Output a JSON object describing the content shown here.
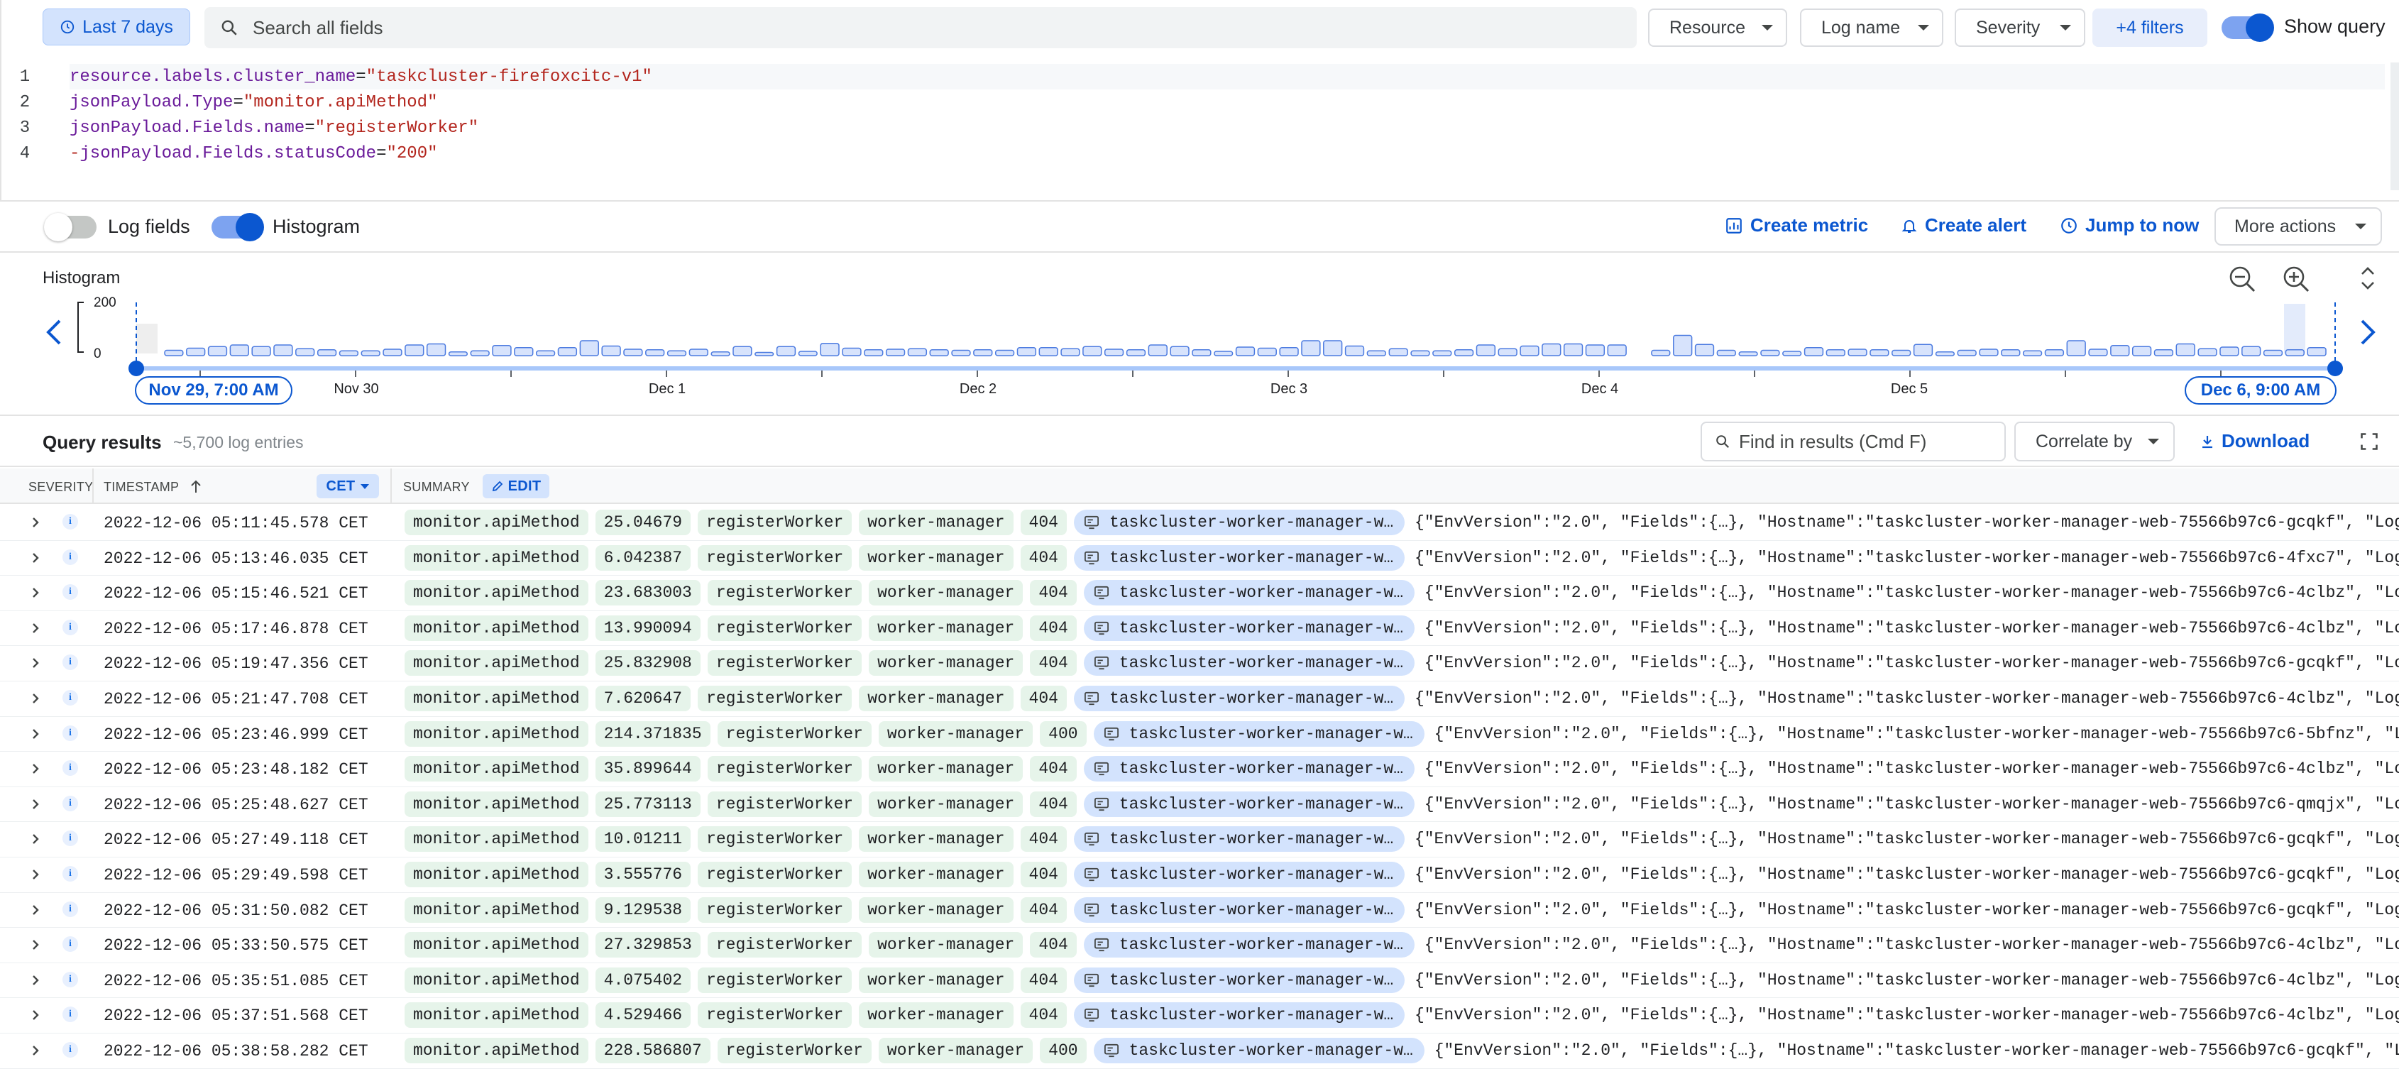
{
  "topbar": {
    "time_range": "Last 7 days",
    "search_placeholder": "Search all fields",
    "resource_label": "Resource",
    "log_name_label": "Log name",
    "severity_label": "Severity",
    "more_filters": "+4 filters",
    "show_query_label": "Show query",
    "show_query_on": true
  },
  "query": {
    "lines": [
      {
        "num": "1",
        "key": "resource.labels.cluster_name",
        "op": "=",
        "value": "\"taskcluster-firefoxcitc-v1\"",
        "negate": ""
      },
      {
        "num": "2",
        "key": "jsonPayload.Type",
        "op": "=",
        "value": "\"monitor.apiMethod\"",
        "negate": ""
      },
      {
        "num": "3",
        "key": "jsonPayload.Fields.name",
        "op": "=",
        "value": "\"registerWorker\"",
        "negate": ""
      },
      {
        "num": "4",
        "key": "jsonPayload.Fields.statusCode",
        "op": "=",
        "value": "\"200\"",
        "negate": "-"
      }
    ]
  },
  "options": {
    "log_fields_label": "Log fields",
    "log_fields_on": false,
    "histogram_label": "Histogram",
    "histogram_on": true,
    "create_metric": "Create metric",
    "create_alert": "Create alert",
    "jump_to_now": "Jump to now",
    "more_actions": "More actions"
  },
  "histogram": {
    "title": "Histogram",
    "y_ticks": [
      "200",
      "0"
    ],
    "x_labels": [
      "Nov 30",
      "Dec 1",
      "Dec 2",
      "Dec 3",
      "Dec 4",
      "Dec 5"
    ],
    "range_start": "Nov 29, 7:00 AM",
    "range_end": "Dec 6, 9:00 AM",
    "ymax": 200,
    "values": [
      20,
      28,
      34,
      40,
      34,
      40,
      26,
      22,
      18,
      18,
      24,
      40,
      44,
      14,
      18,
      38,
      30,
      18,
      30,
      56,
      36,
      24,
      22,
      18,
      24,
      14,
      34,
      12,
      34,
      16,
      46,
      28,
      22,
      24,
      26,
      22,
      20,
      22,
      20,
      30,
      30,
      26,
      34,
      24,
      22,
      40,
      34,
      22,
      16,
      32,
      28,
      30,
      56,
      56,
      36,
      18,
      26,
      18,
      18,
      22,
      40,
      26,
      36,
      44,
      44,
      40,
      40,
      0,
      20,
      76,
      42,
      20,
      14,
      20,
      16,
      30,
      22,
      24,
      22,
      20,
      42,
      14,
      20,
      24,
      22,
      18,
      22,
      56,
      24,
      38,
      34,
      22,
      44,
      26,
      32,
      34,
      20,
      22,
      30
    ]
  },
  "results": {
    "title": "Query results",
    "count": "~5,700 log entries",
    "find_placeholder": "Find in results (Cmd F)",
    "correlate_label": "Correlate by",
    "download_label": "Download",
    "col_severity": "SEVERITY",
    "col_timestamp": "TIMESTAMP",
    "timezone": "CET",
    "col_summary": "SUMMARY",
    "edit_label": "EDIT",
    "rows": [
      {
        "ts": "2022-12-06 05:11:45.578 CET",
        "type": "monitor.apiMethod",
        "dur": "25.04679",
        "name": "registerWorker",
        "svc": "worker-manager",
        "code": "404",
        "host": "taskcluster-worker-manager-web…",
        "json": "{\"EnvVersion\":\"2.0\", \"Fields\":{…}, \"Hostname\":\"taskcluster-worker-manager-web-75566b97c6-gcqkf\", \"Logg…"
      },
      {
        "ts": "2022-12-06 05:13:46.035 CET",
        "type": "monitor.apiMethod",
        "dur": "6.042387",
        "name": "registerWorker",
        "svc": "worker-manager",
        "code": "404",
        "host": "taskcluster-worker-manager-web…",
        "json": "{\"EnvVersion\":\"2.0\", \"Fields\":{…}, \"Hostname\":\"taskcluster-worker-manager-web-75566b97c6-4fxc7\", \"Logg…"
      },
      {
        "ts": "2022-12-06 05:15:46.521 CET",
        "type": "monitor.apiMethod",
        "dur": "23.683003",
        "name": "registerWorker",
        "svc": "worker-manager",
        "code": "404",
        "host": "taskcluster-worker-manager-web…",
        "json": "{\"EnvVersion\":\"2.0\", \"Fields\":{…}, \"Hostname\":\"taskcluster-worker-manager-web-75566b97c6-4clbz\", \"Log…"
      },
      {
        "ts": "2022-12-06 05:17:46.878 CET",
        "type": "monitor.apiMethod",
        "dur": "13.990094",
        "name": "registerWorker",
        "svc": "worker-manager",
        "code": "404",
        "host": "taskcluster-worker-manager-web…",
        "json": "{\"EnvVersion\":\"2.0\", \"Fields\":{…}, \"Hostname\":\"taskcluster-worker-manager-web-75566b97c6-4clbz\", \"Log…"
      },
      {
        "ts": "2022-12-06 05:19:47.356 CET",
        "type": "monitor.apiMethod",
        "dur": "25.832908",
        "name": "registerWorker",
        "svc": "worker-manager",
        "code": "404",
        "host": "taskcluster-worker-manager-web…",
        "json": "{\"EnvVersion\":\"2.0\", \"Fields\":{…}, \"Hostname\":\"taskcluster-worker-manager-web-75566b97c6-gcqkf\", \"Log…"
      },
      {
        "ts": "2022-12-06 05:21:47.708 CET",
        "type": "monitor.apiMethod",
        "dur": "7.620647",
        "name": "registerWorker",
        "svc": "worker-manager",
        "code": "404",
        "host": "taskcluster-worker-manager-web…",
        "json": "{\"EnvVersion\":\"2.0\", \"Fields\":{…}, \"Hostname\":\"taskcluster-worker-manager-web-75566b97c6-4clbz\", \"Logg…"
      },
      {
        "ts": "2022-12-06 05:23:46.999 CET",
        "type": "monitor.apiMethod",
        "dur": "214.371835",
        "name": "registerWorker",
        "svc": "worker-manager",
        "code": "400",
        "host": "taskcluster-worker-manager-web…",
        "json": "{\"EnvVersion\":\"2.0\", \"Fields\":{…}, \"Hostname\":\"taskcluster-worker-manager-web-75566b97c6-5bfnz\", \"Lo…"
      },
      {
        "ts": "2022-12-06 05:23:48.182 CET",
        "type": "monitor.apiMethod",
        "dur": "35.899644",
        "name": "registerWorker",
        "svc": "worker-manager",
        "code": "404",
        "host": "taskcluster-worker-manager-web…",
        "json": "{\"EnvVersion\":\"2.0\", \"Fields\":{…}, \"Hostname\":\"taskcluster-worker-manager-web-75566b97c6-4clbz\", \"Log…"
      },
      {
        "ts": "2022-12-06 05:25:48.627 CET",
        "type": "monitor.apiMethod",
        "dur": "25.773113",
        "name": "registerWorker",
        "svc": "worker-manager",
        "code": "404",
        "host": "taskcluster-worker-manager-web…",
        "json": "{\"EnvVersion\":\"2.0\", \"Fields\":{…}, \"Hostname\":\"taskcluster-worker-manager-web-75566b97c6-qmqjx\", \"Log…"
      },
      {
        "ts": "2022-12-06 05:27:49.118 CET",
        "type": "monitor.apiMethod",
        "dur": "10.01211",
        "name": "registerWorker",
        "svc": "worker-manager",
        "code": "404",
        "host": "taskcluster-worker-manager-web…",
        "json": "{\"EnvVersion\":\"2.0\", \"Fields\":{…}, \"Hostname\":\"taskcluster-worker-manager-web-75566b97c6-gcqkf\", \"Logg…"
      },
      {
        "ts": "2022-12-06 05:29:49.598 CET",
        "type": "monitor.apiMethod",
        "dur": "3.555776",
        "name": "registerWorker",
        "svc": "worker-manager",
        "code": "404",
        "host": "taskcluster-worker-manager-web…",
        "json": "{\"EnvVersion\":\"2.0\", \"Fields\":{…}, \"Hostname\":\"taskcluster-worker-manager-web-75566b97c6-gcqkf\", \"Logg…"
      },
      {
        "ts": "2022-12-06 05:31:50.082 CET",
        "type": "monitor.apiMethod",
        "dur": "9.129538",
        "name": "registerWorker",
        "svc": "worker-manager",
        "code": "404",
        "host": "taskcluster-worker-manager-web…",
        "json": "{\"EnvVersion\":\"2.0\", \"Fields\":{…}, \"Hostname\":\"taskcluster-worker-manager-web-75566b97c6-gcqkf\", \"Logg…"
      },
      {
        "ts": "2022-12-06 05:33:50.575 CET",
        "type": "monitor.apiMethod",
        "dur": "27.329853",
        "name": "registerWorker",
        "svc": "worker-manager",
        "code": "404",
        "host": "taskcluster-worker-manager-web…",
        "json": "{\"EnvVersion\":\"2.0\", \"Fields\":{…}, \"Hostname\":\"taskcluster-worker-manager-web-75566b97c6-4clbz\", \"Log…"
      },
      {
        "ts": "2022-12-06 05:35:51.085 CET",
        "type": "monitor.apiMethod",
        "dur": "4.075402",
        "name": "registerWorker",
        "svc": "worker-manager",
        "code": "404",
        "host": "taskcluster-worker-manager-web…",
        "json": "{\"EnvVersion\":\"2.0\", \"Fields\":{…}, \"Hostname\":\"taskcluster-worker-manager-web-75566b97c6-4clbz\", \"Logg…"
      },
      {
        "ts": "2022-12-06 05:37:51.568 CET",
        "type": "monitor.apiMethod",
        "dur": "4.529466",
        "name": "registerWorker",
        "svc": "worker-manager",
        "code": "404",
        "host": "taskcluster-worker-manager-web…",
        "json": "{\"EnvVersion\":\"2.0\", \"Fields\":{…}, \"Hostname\":\"taskcluster-worker-manager-web-75566b97c6-4clbz\", \"Logg…"
      },
      {
        "ts": "2022-12-06 05:38:58.282 CET",
        "type": "monitor.apiMethod",
        "dur": "228.586807",
        "name": "registerWorker",
        "svc": "worker-manager",
        "code": "400",
        "host": "taskcluster-worker-manager-web…",
        "json": "{\"EnvVersion\":\"2.0\", \"Fields\":{…}, \"Hostname\":\"taskcluster-worker-manager-web-75566b97c6-gcqkf\", \"Lo…"
      }
    ]
  },
  "colors": {
    "accent": "#0b57d0",
    "chip_green": "#e6f4ea",
    "chip_blue": "#d3e3fd",
    "bar_fill": "#d7e3fc",
    "bar_stroke": "#4c7be0"
  },
  "icons": {
    "time": "clock-icon",
    "search": "search-icon",
    "metric": "chart-icon",
    "alert": "bell-icon",
    "jump": "clock-icon",
    "zoom_out": "zoom-out-icon",
    "zoom_in": "zoom-in-icon",
    "download": "download-icon",
    "fullscreen": "fullscreen-icon",
    "host": "server-icon",
    "expand": "chevron-right-icon",
    "severity": "info-icon"
  }
}
